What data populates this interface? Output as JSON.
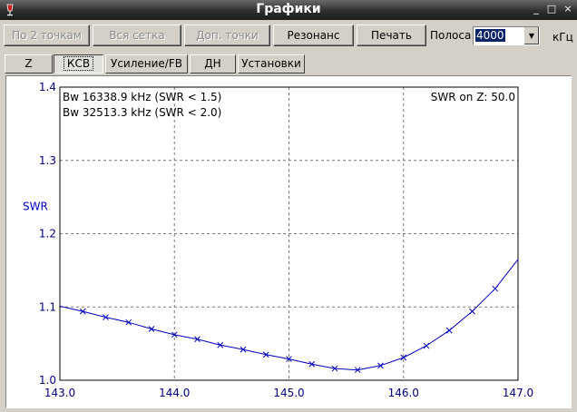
{
  "window": {
    "title": "Графики",
    "controls": [
      "_",
      "□",
      "×"
    ]
  },
  "toolbar": {
    "buttons": [
      {
        "label": "По 2 точкам",
        "enabled": false
      },
      {
        "label": "Вся сетка",
        "enabled": false
      },
      {
        "label": "Доп. точки",
        "enabled": false
      },
      {
        "label": "Резонанс",
        "enabled": true
      },
      {
        "label": "Печать",
        "enabled": true
      }
    ],
    "band_label": "Полоса",
    "band_value": "4000",
    "unit": "кГц"
  },
  "tabs": [
    {
      "label": "Z",
      "active": false
    },
    {
      "label": "КСВ",
      "active": true
    },
    {
      "label": "Усиление/FB",
      "active": false
    },
    {
      "label": "ДН",
      "active": false
    },
    {
      "label": "Установки",
      "active": false
    }
  ],
  "chart_data": {
    "type": "line",
    "ylabel": "SWR",
    "xlim": [
      143.0,
      147.0
    ],
    "ylim": [
      1.0,
      1.4
    ],
    "x_ticks": [
      "143.0",
      "144.0",
      "145.0",
      "146.0",
      "147.0"
    ],
    "y_ticks": [
      "1.0",
      "1.1",
      "1.2",
      "1.3",
      "1.4"
    ],
    "grid": true,
    "annotations": {
      "bw1": "Bw 16338.9 kHz (SWR < 1.5)",
      "bw2": "Bw 32513.3 kHz (SWR < 2.0)",
      "z": "SWR on Z: 50.0"
    },
    "color": "#0000c0",
    "series": [
      {
        "x": [
          143.0,
          143.2,
          143.4,
          143.6,
          143.8,
          144.0,
          144.2,
          144.4,
          144.6,
          144.8,
          145.0,
          145.2,
          145.4,
          145.6,
          145.8,
          146.0,
          146.2,
          146.4,
          146.6,
          146.8,
          147.0
        ],
        "y": [
          1.101,
          1.094,
          1.086,
          1.079,
          1.07,
          1.062,
          1.056,
          1.048,
          1.042,
          1.035,
          1.029,
          1.022,
          1.016,
          1.014,
          1.02,
          1.031,
          1.047,
          1.068,
          1.094,
          1.125,
          1.165
        ]
      }
    ]
  }
}
